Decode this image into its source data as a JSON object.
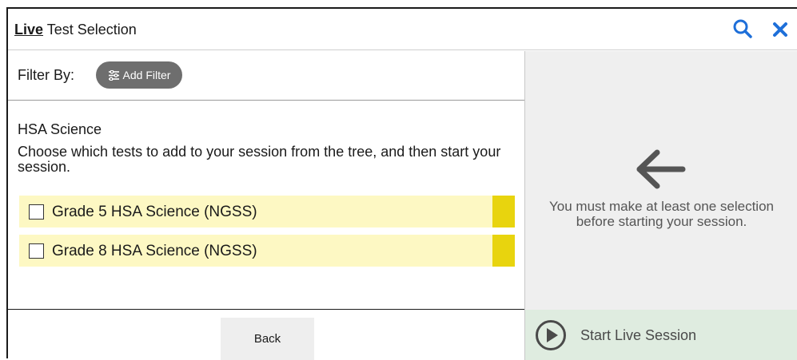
{
  "header": {
    "title_live": "Live",
    "title_rest": " Test Selection",
    "search_icon": "search-icon",
    "close_icon": "close-icon",
    "accent_color": "#1e6fd9"
  },
  "filter": {
    "label": "Filter By:",
    "add_filter_label": "Add Filter",
    "add_filter_icon": "sliders-icon"
  },
  "content": {
    "subject": "HSA Science",
    "instructions": "Choose which tests to add to your session from the tree, and then start your session."
  },
  "tests": [
    {
      "label": "Grade 5 HSA Science (NGSS)",
      "checked": false
    },
    {
      "label": "Grade 8 HSA Science (NGSS)",
      "checked": false
    }
  ],
  "footer": {
    "back_label": "Back",
    "start_label": "Start Live Session",
    "start_icon": "play-circle-icon"
  },
  "hint": {
    "line1": "You must make at least one selection",
    "line2": "before starting your session.",
    "icon": "arrow-left-icon"
  },
  "colors": {
    "row_bg": "#fdf8c3",
    "row_accent": "#e8d40e",
    "start_bg": "#dfece0"
  }
}
